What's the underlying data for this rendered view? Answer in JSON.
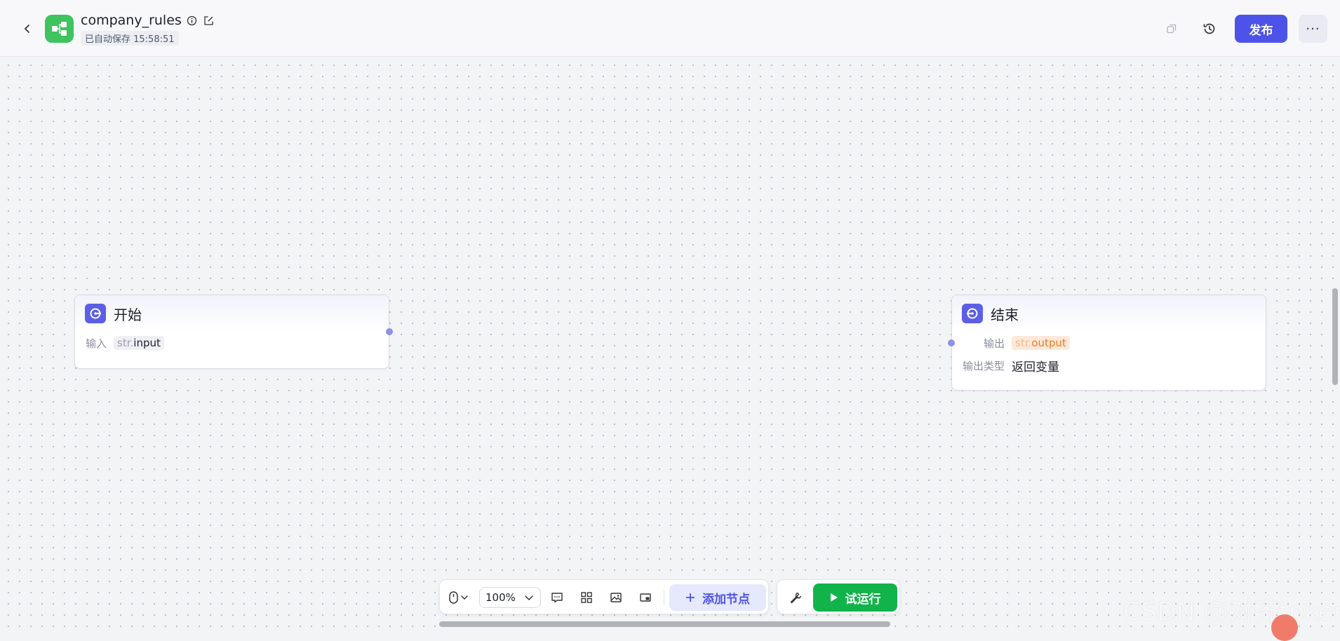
{
  "header": {
    "title": "company_rules",
    "autosave": "已自动保存 15:58:51",
    "publish_label": "发布",
    "more_label": "···"
  },
  "nodes": {
    "start": {
      "title": "开始",
      "input_label": "输入",
      "input_type": "str.",
      "input_name": "input"
    },
    "end": {
      "title": "结束",
      "output_label": "输出",
      "output_type": "str.",
      "output_name": "output",
      "output_type_label": "输出类型",
      "output_type_value": "返回变量"
    }
  },
  "toolbar": {
    "zoom": "100%",
    "add_node_label": "添加节点",
    "run_label": "试运行"
  },
  "watermark": "CSDN @对齐token",
  "colors": {
    "primary": "#4d53e8",
    "run": "#12b34a",
    "logo": "#3fc35f",
    "output_tag": "#ef7a1d"
  }
}
